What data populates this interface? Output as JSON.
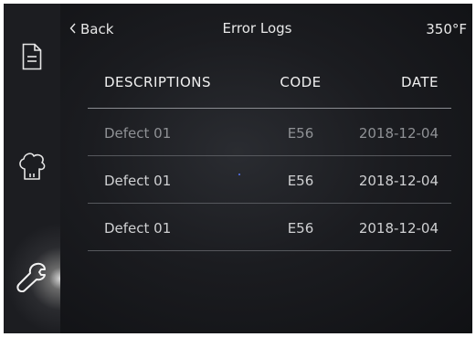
{
  "header": {
    "back_label": "Back",
    "title": "Error Logs",
    "temperature": "350°F"
  },
  "sidebar": {
    "items": [
      {
        "icon": "document-icon"
      },
      {
        "icon": "chef-hat-icon"
      },
      {
        "icon": "wrench-icon",
        "active": true
      }
    ]
  },
  "table": {
    "columns": [
      "DESCRIPTIONS",
      "CODE",
      "DATE"
    ],
    "rows": [
      {
        "description": "Defect 01",
        "code": "E56",
        "date": "2018-12-04"
      },
      {
        "description": "Defect 01",
        "code": "E56",
        "date": "2018-12-04"
      },
      {
        "description": "Defect 01",
        "code": "E56",
        "date": "2018-12-04"
      }
    ]
  },
  "colors": {
    "background": "#16171b",
    "text": "#e0e0e0",
    "divider": "#56585d"
  }
}
